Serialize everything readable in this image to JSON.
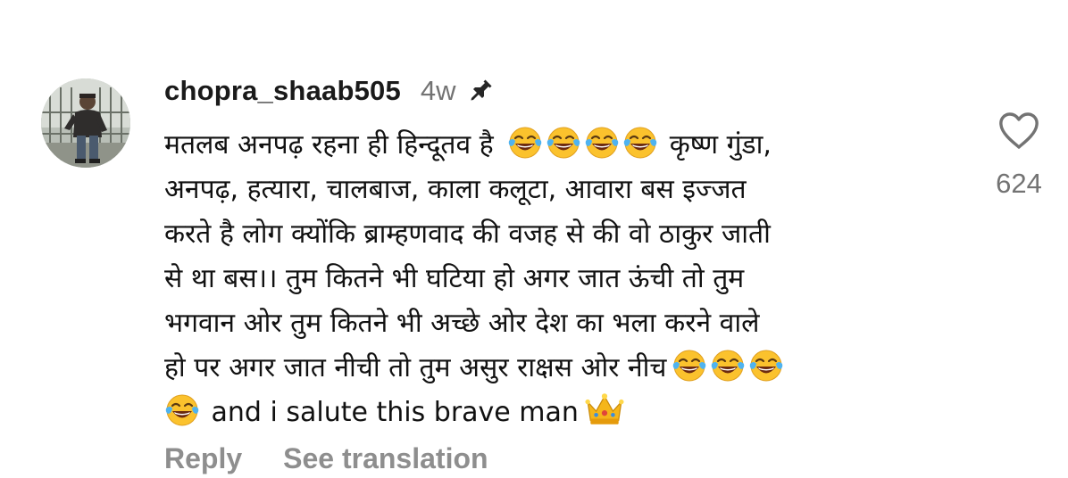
{
  "comment": {
    "username": "chopra_shaab505",
    "time_ago": "4w",
    "pinned": true,
    "lines": [
      {
        "pre": "मतलब अनपढ़ रहना ही हिन्दूतव है ",
        "emojis_after": 4,
        "post": " कृष्ण गुंडा,"
      },
      {
        "text": "अनपढ़, हत्यारा, चालबाज, काला कलूटा, आवारा बस इज्जत"
      },
      {
        "text": "करते है लोग क्योंकि ब्राम्हणवाद की वजह से की वो ठाकुर जाती"
      },
      {
        "text": "से था बस।। तुम कितने भी घटिया हो अगर जात ऊंची तो तुम"
      },
      {
        "text": "भगवान ओर तुम कितने भी अच्छे ओर देश का भला करने वाले"
      },
      {
        "text": "हो पर अगर जात नीची तो तुम असुर राक्षस ओर नीच",
        "emojis_after": 3
      },
      {
        "emojis_before": 1,
        "text": " and i salute this brave man",
        "crown": true
      }
    ],
    "emoji_laugh": "face-with-tears-of-joy-icon",
    "emoji_crown": "crown-icon",
    "like_count": "624",
    "reply_label": "Reply",
    "translate_label": "See translation"
  },
  "colors": {
    "text": "#111111",
    "muted": "#737373",
    "action": "#8e8e8e",
    "emoji_face": "#fbc22d"
  }
}
